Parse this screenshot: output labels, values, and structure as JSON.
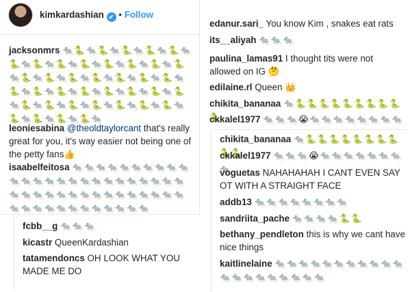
{
  "header": {
    "username": "kimkardashian",
    "verified_glyph": "✔",
    "separator": "•",
    "follow_label": "Follow"
  },
  "left": {
    "comments": [
      {
        "user": "jacksonmrs",
        "text": "🐀🐍🐀🐍🐀🐍🐀🐍🐀🐍🐀🐍🐀🐍🐀🐍🐀🐍🐀🐍🐀🐍🐀🐍🐀🐍🐀🐍🐀🐍🐀🐍🐀🐍🐀🐍🐀🐍🐀🐍🐀🐍🐀🐍🐀🐍🐀🐍🐀🐍🐀🐍🐀🐍🐀🐍🐀🐍🐀🐍🐀🐍🐀🐍🐀🐍🐀🐍🐀🐍🐀🐍🐀🐍🐀🐍🐀🐍🐀"
      },
      {
        "user": "leoniesabina",
        "mention": "@theoldtaylorcant",
        "text": " that's really great for you, it's way easier not being one of the petty fans👍"
      },
      {
        "user": "isaabelfeitosa",
        "text": "🐀🐀🐀🐀🐀🐀🐀🐀🐀🐀🐀🐀🐀🐀🐀🐀🐀🐀🐀🐀🐀🐀🐀🐀🐀🐀🐀🐀🐀🐀🐀🐀🐀🐀🐀🐀🐀🐀🐀🐀🐀🐀🐀🐀🐀🐀🐀🐀🐀🐀🐀🐀"
      }
    ]
  },
  "left_bottom": {
    "comments": [
      {
        "user": "fcbb__g",
        "text": "🐀🐀🐀"
      },
      {
        "user": "kicastr",
        "text": "QueenKardashian"
      },
      {
        "user": "tatamendoncs",
        "text": "OH LOOK WHAT YOU MADE ME DO"
      }
    ]
  },
  "right_top": {
    "comments": [
      {
        "user": "edanur.sari_",
        "text": "You know Kim , snakes eat rats"
      },
      {
        "user": "its__aliyah",
        "text": "🐀🐀🐀"
      },
      {
        "user": "paulina_lamas91",
        "text": "I thought tits were not allowed on IG 🤔"
      },
      {
        "user": "edilaine.rl",
        "text": "Queen 👑"
      },
      {
        "user": "chikita_bananaa",
        "text": "🐀🐍🐍🐍🐍🐍🐍🐍🐍🐍🐍"
      },
      {
        "user": "ckkalel1977",
        "text": "🐀🐀🐀😭🐀🐀🐀🐀🐀🐀🐀🐀"
      }
    ]
  },
  "right_bottom": {
    "comments": [
      {
        "user": "chikita_bananaa",
        "text": "🐀🐍🐍🐍🐍🐍🐍🐍🐍🐍🐍"
      },
      {
        "user": "ckkalel1977",
        "text": "🐀🐀🐀😭🐀🐀🐀🐀🐀🐀🐀🐀"
      },
      {
        "user": "voguetas",
        "text": "NAHAHAHAH I CANT EVEN SAY OT WITH A STRAIGHT FACE"
      },
      {
        "user": "addb13",
        "text": "🐀🐀🐀🐀🐀🐀🐀🐀"
      },
      {
        "user": "sandriita_pache",
        "text": "🐀🐀🐀🐀🐍🐍"
      },
      {
        "user": "bethany_pendleton",
        "text": "this is why we cant have nice things"
      },
      {
        "user": "kaitlinelaine",
        "text": "🐀🐀🐀🐀🐀🐀🐀🐀🐀🐀🐀🐀🐀🐀🐀🐀🐀🐀🐀🐀"
      }
    ]
  }
}
